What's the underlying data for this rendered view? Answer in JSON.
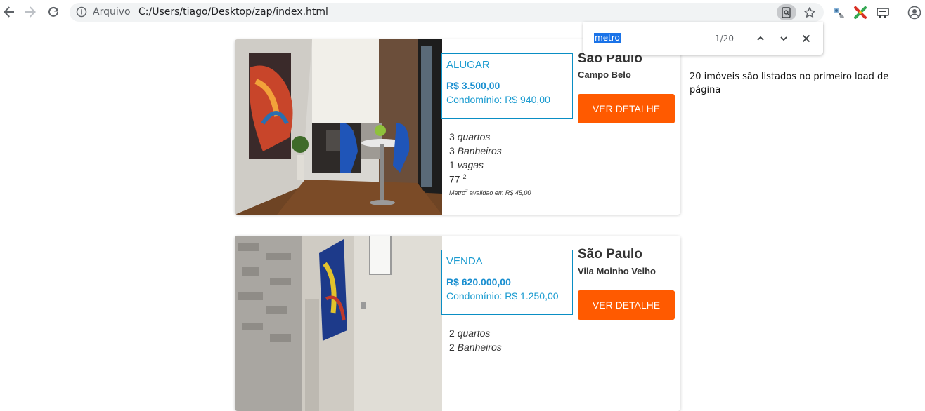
{
  "browser": {
    "origin_label": "Arquivo",
    "url": "C:/Users/tiago/Desktop/zap/index.html",
    "icons": [
      "back-icon",
      "forward-icon",
      "reload-icon",
      "info-icon",
      "find-in-page-icon",
      "bookmark-star-icon",
      "extension-icon",
      "extension-x-icon",
      "cast-icon",
      "account-icon"
    ]
  },
  "find_bar": {
    "query": "metro",
    "count": "1/20",
    "icons": [
      "chevron-up-icon",
      "chevron-down-icon",
      "close-icon"
    ]
  },
  "listings": [
    {
      "type": "ALUGAR",
      "price": "R$ 3.500,00",
      "condo": "Condomínio: R$ 940,00",
      "city": "São Paulo",
      "neighborhood": "Campo Belo",
      "button": "VER DETALHE",
      "rooms_num": "3",
      "rooms_label": "quartos",
      "baths_num": "3",
      "baths_label": "Banheiros",
      "parking_num": "1",
      "parking_label": "vagas",
      "area": "77",
      "area_unit": "2",
      "note_prefix": "Metro",
      "note_sup": "2",
      "note_suffix": " avalidao em R$ 45,00"
    },
    {
      "type": "VENDA",
      "price": "R$ 620.000,00",
      "condo": "Condomínio: R$ 1.250,00",
      "city": "São Paulo",
      "neighborhood": "Vila Moinho Velho",
      "button": "VER DETALHE",
      "rooms_num": "2",
      "rooms_label": "quartos",
      "baths_num": "2",
      "baths_label": "Banheiros"
    }
  ],
  "side_note": "20 imóveis são listados no primeiro load de página",
  "colors": {
    "accent_blue": "#1a9bd0",
    "button_orange": "#ff5a00",
    "find_highlight": "#1a73e8"
  }
}
